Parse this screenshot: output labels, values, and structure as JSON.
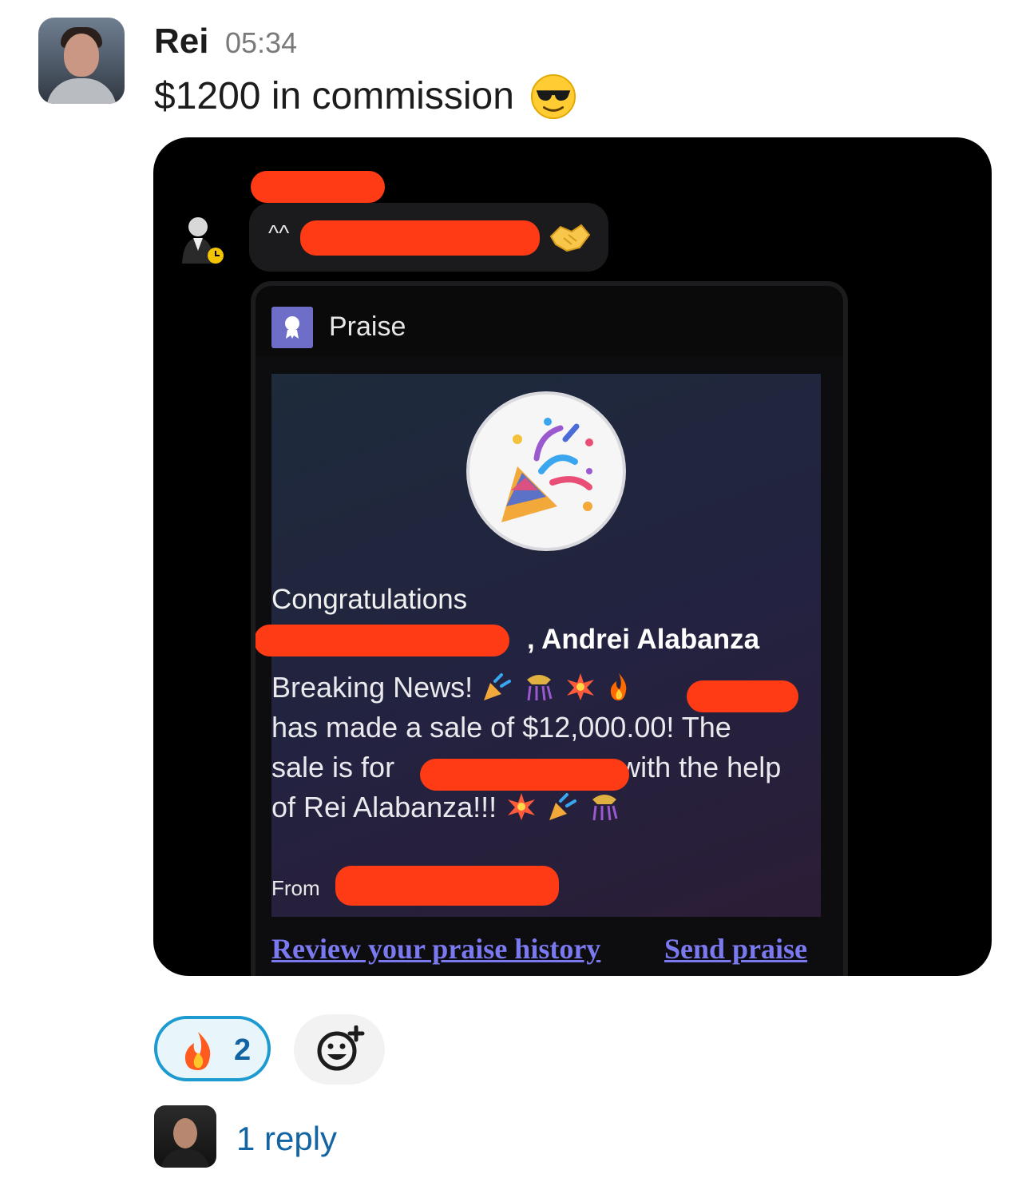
{
  "message": {
    "author": "Rei",
    "timestamp": "05:34",
    "text": "$1200 in commission",
    "emoji": "sunglasses-emoji"
  },
  "attachment": {
    "forwarded_prefix": "^^",
    "praise_card": {
      "header_title": "Praise",
      "congratulations": "Congratulations",
      "recipients_suffix": ", Andrei Alabanza",
      "body_line1": "Breaking News!",
      "body_line2": "has made a sale of $12,000.00! The",
      "body_line3a": "sale is for",
      "body_line3b": "with the help",
      "body_line4": "of Rei Alabanza!!!",
      "from_label": "From",
      "link_history": "Review your praise history",
      "link_send": "Send praise"
    }
  },
  "reactions": [
    {
      "emoji": "fire-emoji",
      "count": "2"
    }
  ],
  "thread": {
    "reply_label": "1 reply"
  },
  "colors": {
    "reaction_border": "#1d9bd1",
    "link_blue": "#1264a3",
    "praise_link": "#7a79f0",
    "redaction": "#ff3b16"
  }
}
